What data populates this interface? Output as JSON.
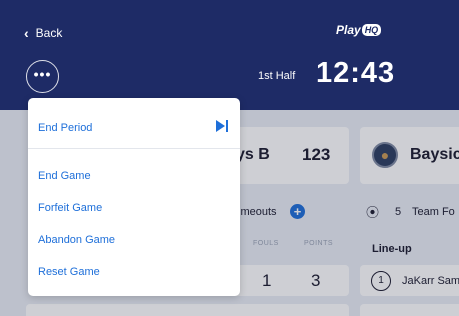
{
  "header": {
    "back_label": "Back",
    "logo": {
      "play": "Play",
      "hq": "HQ"
    },
    "more_label": "•••",
    "period": "1st Half",
    "clock": "12:43"
  },
  "home": {
    "name_partial": "ys B",
    "score": "123",
    "timeouts_label": "imeouts",
    "fouls_header": "FOULS",
    "points_header": "POINTS",
    "player_fouls": "1",
    "player_points": "3"
  },
  "away": {
    "name_partial": "Baysic",
    "team_fouls_count": "5",
    "team_fouls_label": "Team Fo",
    "lineup_label": "Line-up",
    "player_number": "1",
    "player_name": "JaKarr Sam"
  },
  "menu": {
    "items": [
      {
        "label": "End Period"
      },
      {
        "label": "End Game"
      },
      {
        "label": "Forfeit Game"
      },
      {
        "label": "Abandon Game"
      },
      {
        "label": "Reset Game"
      }
    ]
  },
  "colors": {
    "header_bg": "#1E2B66",
    "accent": "#1E6FD9",
    "page_bg": "#E9EEF5"
  },
  "icons": {
    "back": "chevron-left-icon",
    "more": "more-dots-icon",
    "end_period": "skip-end-icon",
    "add_timeout": "plus-circle-icon",
    "whistle": "whistle-icon",
    "away_badge": "basketball-icon"
  }
}
